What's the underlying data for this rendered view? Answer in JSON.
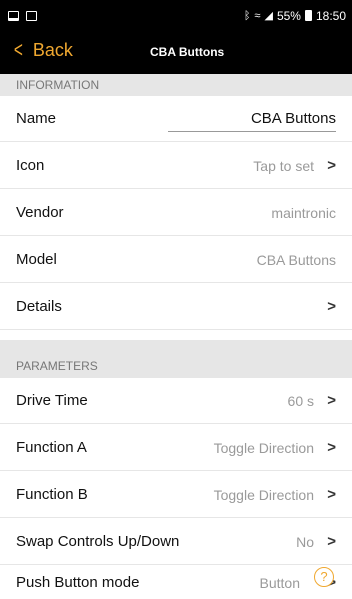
{
  "status_bar": {
    "battery_percent": "55%",
    "time": "18:50",
    "icons": [
      "image-icon",
      "clipboard-icon",
      "bluetooth-icon",
      "wifi-icon",
      "signal-icon",
      "battery-icon"
    ]
  },
  "nav": {
    "back_label": "Back",
    "title": "CBA Buttons",
    "accent_color": "#f0a830"
  },
  "information": {
    "header": "INFORMATION",
    "name_label": "Name",
    "name_value": "CBA Buttons",
    "icon_label": "Icon",
    "icon_value": "Tap to set",
    "vendor_label": "Vendor",
    "vendor_value": "maintronic",
    "model_label": "Model",
    "model_value": "CBA Buttons",
    "details_label": "Details"
  },
  "parameters": {
    "header": "PARAMETERS",
    "items": [
      {
        "label": "Drive Time",
        "value": "60 s"
      },
      {
        "label": "Function A",
        "value": "Toggle Direction"
      },
      {
        "label": "Function B",
        "value": "Toggle Direction"
      },
      {
        "label": "Swap Controls Up/Down",
        "value": "No"
      },
      {
        "label": "Push Button mode",
        "value": "Button"
      }
    ]
  },
  "chevron_glyph": ">",
  "help_glyph": "?"
}
